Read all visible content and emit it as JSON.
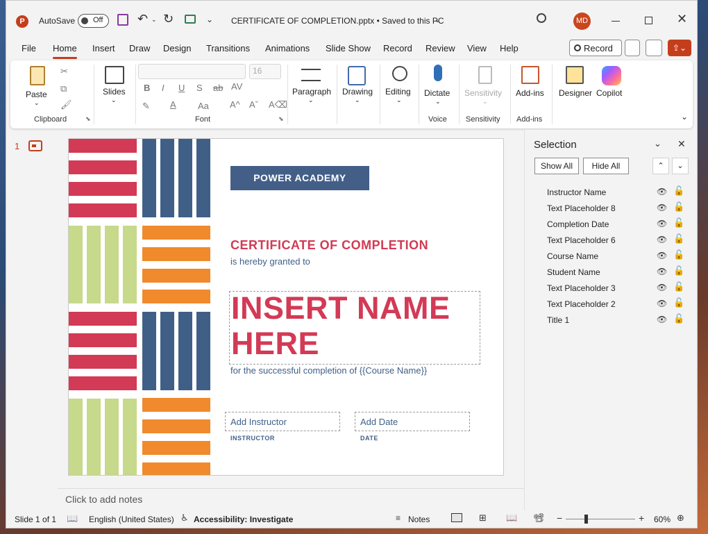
{
  "titlebar": {
    "autosave_label": "AutoSave",
    "autosave_toggle": "Off",
    "doc_title": "CERTIFICATE OF COMPLETION.pptx • Saved to this PC",
    "user_initials": "MD",
    "accent": "#c43e1c"
  },
  "menu_tabs": [
    "File",
    "Home",
    "Insert",
    "Draw",
    "Design",
    "Transitions",
    "Animations",
    "Slide Show",
    "Record",
    "Review",
    "View",
    "Help"
  ],
  "record_button": "Record",
  "ribbon": {
    "paste": "Paste",
    "slides": "Slides",
    "font_size": "16",
    "paragraph": "Paragraph",
    "drawing": "Drawing",
    "editing": "Editing",
    "dictate": "Dictate",
    "sensitivity": "Sensitivity",
    "addins": "Add-ins",
    "designer": "Designer",
    "copilot": "Copilot",
    "groups": {
      "clipboard": "Clipboard",
      "font": "Font",
      "voice": "Voice",
      "sensitivity": "Sensitivity",
      "addins": "Add-ins"
    }
  },
  "thumbnail": {
    "number": "1"
  },
  "slide": {
    "banner": "POWER ACADEMY",
    "heading": "CERTIFICATE OF COMPLETION",
    "granted": "is hereby granted to",
    "name_line1": "INSERT NAME",
    "name_line2": "HERE",
    "completion": "for the successful completion of {{Course Name}}",
    "instructor_placeholder": "Add Instructor",
    "instructor_label": "INSTRUCTOR",
    "date_placeholder": "Add Date",
    "date_label": "DATE",
    "colors": {
      "red": "#d23a55",
      "blue": "#3f5f87",
      "green": "#c7d98a",
      "orange": "#f08a2c",
      "banner": "#435f88"
    }
  },
  "notes_placeholder": "Click to add notes",
  "selection_pane": {
    "title": "Selection",
    "show_all": "Show All",
    "hide_all": "Hide All",
    "items": [
      "Instructor Name",
      "Text Placeholder 8",
      "Completion Date",
      "Text Placeholder 6",
      "Course Name",
      "Student Name",
      "Text Placeholder 3",
      "Text Placeholder 2",
      "Title 1"
    ]
  },
  "status": {
    "slide_info": "Slide 1 of 1",
    "language": "English (United States)",
    "accessibility": "Accessibility: Investigate",
    "notes": "Notes",
    "zoom": "60%"
  }
}
